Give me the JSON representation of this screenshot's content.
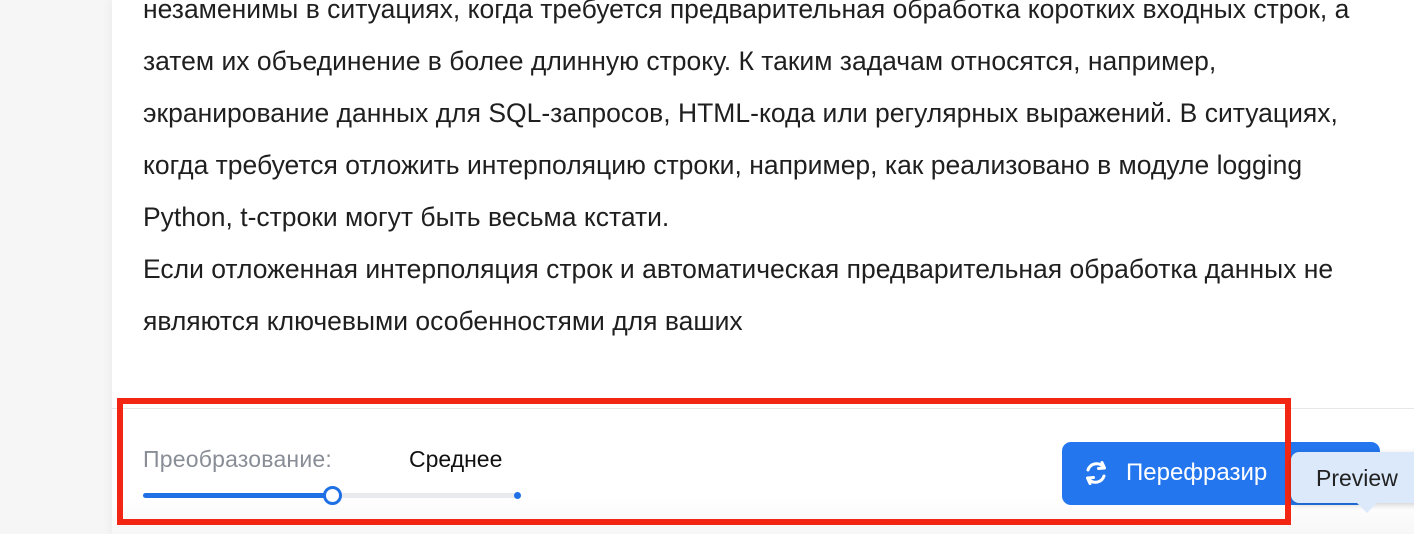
{
  "document": {
    "paragraphs": [
      "незаменимы в ситуациях, когда требуется предварительная обработка коротких входных строк, а затем их объединение в более длинную строку. К таким задачам относятся, например, экранирование данных для SQL-запросов, HTML-кода или регулярных выражений. В ситуациях, когда требуется отложить интерполяцию строки, например, как реализовано в модуле logging Python, t-строки могут быть весьма кстати.",
      "Если отложенная интерполяция строк и автоматическая предварительная обработка данных не являются ключевыми особенностями для ваших"
    ]
  },
  "controls": {
    "transform_label": "Преобразование:",
    "transform_value": "Среднее",
    "transform_level_percent": 50,
    "rephrase_button_label": "Перефразир",
    "rephrase_icon": "refresh-icon"
  },
  "tooltip": {
    "text": "Preview"
  },
  "colors": {
    "accent": "#2476ee",
    "highlight": "#f22613",
    "tooltip_bg": "#dce9fb"
  }
}
